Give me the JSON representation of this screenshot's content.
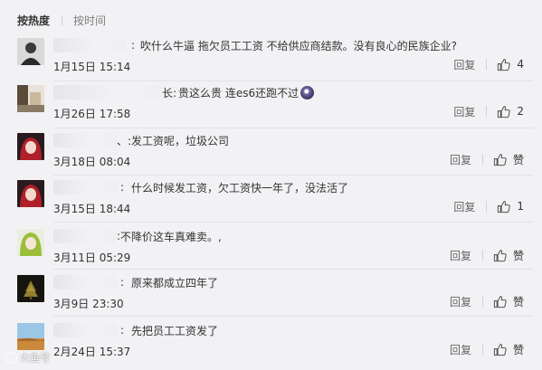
{
  "tabs": [
    {
      "label": "按热度",
      "active": true
    },
    {
      "label": "按时间",
      "active": false
    }
  ],
  "reply_label": "回复",
  "like_icon": "thumbs-up-icon",
  "comments": [
    {
      "text": "吹什么牛逼 拖欠员工工资 不给供应商结款。没有良心的民族企业?",
      "prefix": ":",
      "time": "1月15日 15:14",
      "likes": "4",
      "avatar": "man-portrait"
    },
    {
      "text": "贵这么贵 连es6还跑不过",
      "prefix": "长:",
      "time": "1月26日 17:58",
      "likes": "2",
      "avatar": "room-photo"
    },
    {
      "text": "发工资呢，垃圾公司",
      "prefix": "、:",
      "time": "3月18日 08:04",
      "likes": "赞",
      "avatar": "red-hair-anime"
    },
    {
      "text": "什么时候发工资，欠工资快一年了，没法活了",
      "prefix": ":",
      "time": "3月15日 18:44",
      "likes": "1",
      "avatar": "red-hair-anime"
    },
    {
      "text": "不降价这车真难卖。,",
      "prefix": ":",
      "time": "3月11日 05:29",
      "likes": "赞",
      "avatar": "green-hair-anime"
    },
    {
      "text": "原来都成立四年了",
      "prefix": ":",
      "time": "3月9日 23:30",
      "likes": "赞",
      "avatar": "dark-tree"
    },
    {
      "text": "先把员工工资发了",
      "prefix": ":",
      "time": "2月24日 15:37",
      "likes": "赞",
      "avatar": "landscape"
    }
  ],
  "watermark": "大鱼号"
}
